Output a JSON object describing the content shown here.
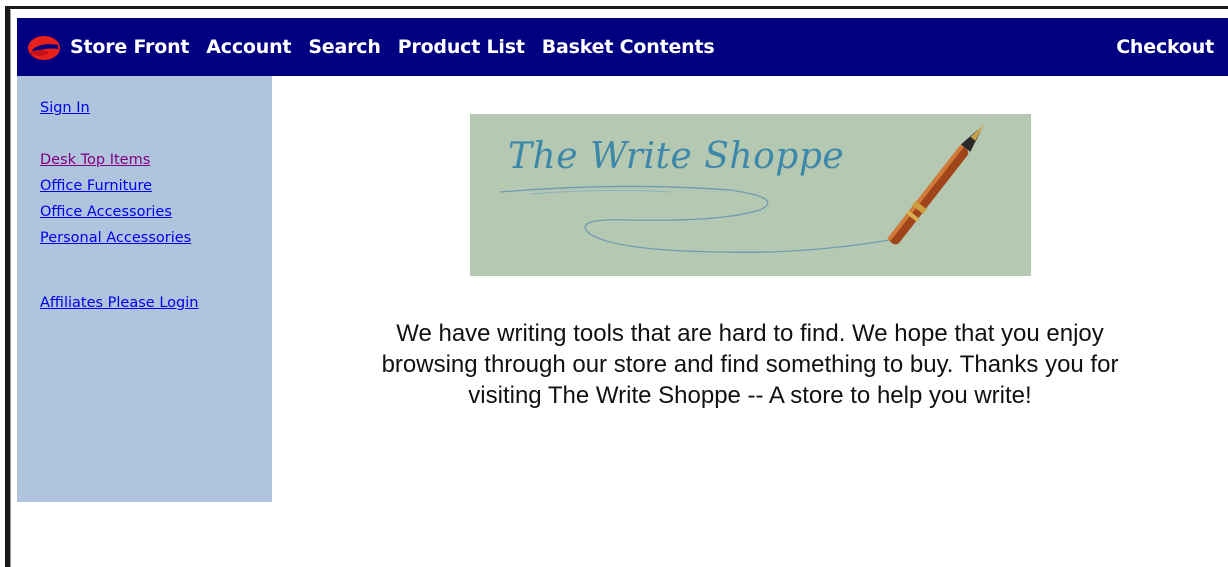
{
  "navbar": {
    "logo_icon": "store-logo-icon",
    "items": [
      "Store Front",
      "Account",
      "Search",
      "Product List",
      "Basket Contents"
    ],
    "checkout_label": "Checkout",
    "background_color": "#000080"
  },
  "sidebar": {
    "sign_in_label": "Sign In",
    "categories": [
      "Desk Top Items",
      "Office Furniture",
      "Office Accessories",
      "Personal Accessories"
    ],
    "affiliates_label": "Affiliates Please Login",
    "background_color": "#b0c4de"
  },
  "banner": {
    "title": "The Write Shoppe",
    "icon": "fountain-pen-icon"
  },
  "main": {
    "intro_text": "We have writing tools that are hard to find. We hope that you enjoy browsing through our store and find something to buy. Thanks you for visiting The Write Shoppe -- A store to help you write!"
  }
}
